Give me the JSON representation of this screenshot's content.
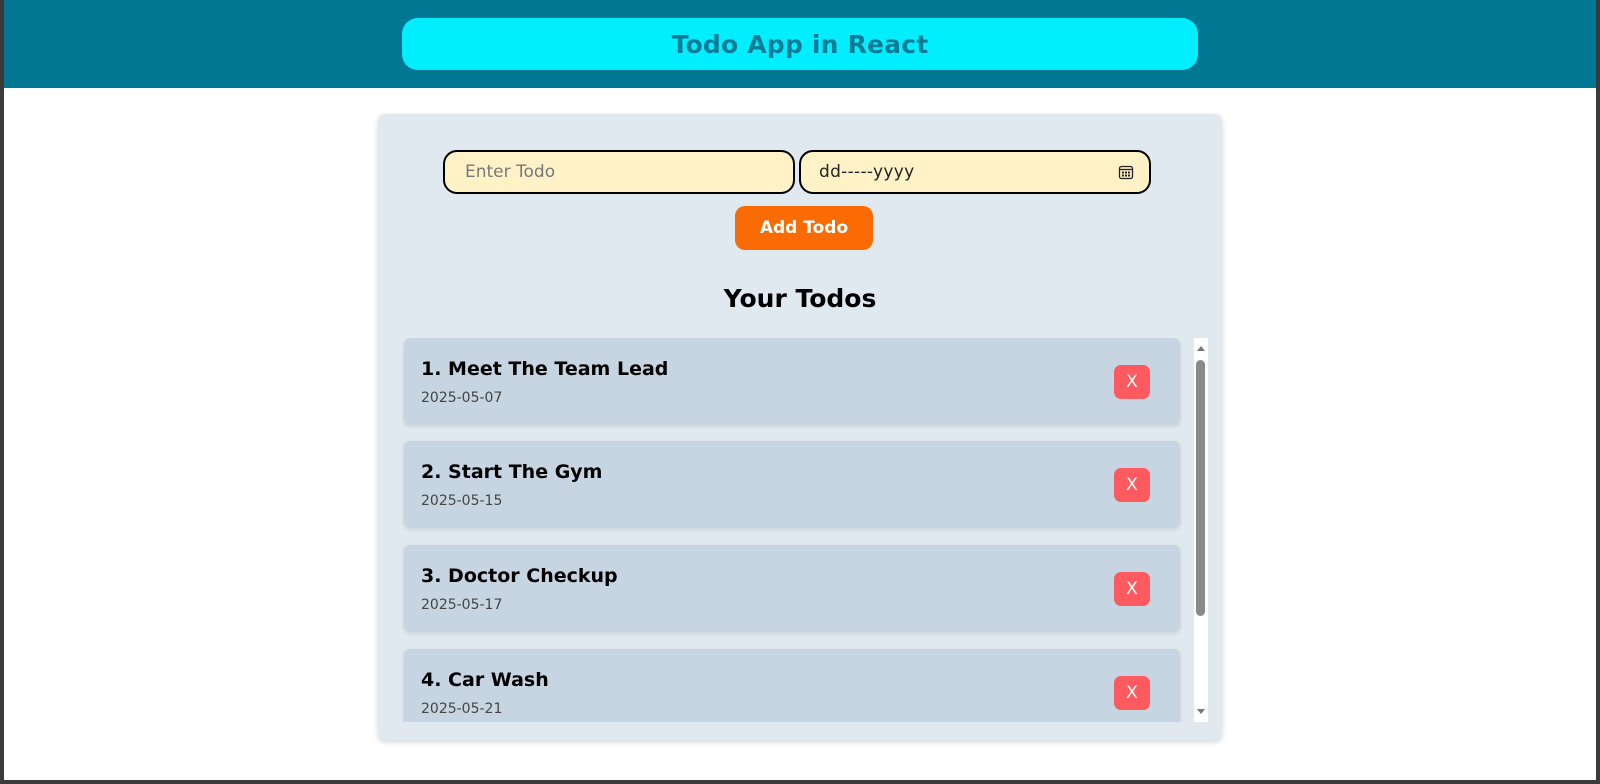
{
  "header": {
    "title": "Todo App in React"
  },
  "form": {
    "todo_placeholder": "Enter Todo",
    "todo_value": "",
    "date_placeholder": "dd-----yyyy",
    "add_button_label": "Add Todo"
  },
  "list": {
    "heading": "Your Todos",
    "delete_label": "X",
    "items": [
      {
        "text": "1. Meet The Team Lead",
        "date": "2025-05-07"
      },
      {
        "text": "2. Start The Gym",
        "date": "2025-05-15"
      },
      {
        "text": "3. Doctor Checkup",
        "date": "2025-05-17"
      },
      {
        "text": "4. Car Wash",
        "date": "2025-05-21"
      }
    ]
  },
  "colors": {
    "header_bg": "#007894",
    "title_pill": "#00eeff",
    "title_text": "#0a7c95",
    "card_bg": "#e0e8f0",
    "input_bg": "#fff2c6",
    "add_button": "#fb6b04",
    "item_bg": "#c6d5e1",
    "delete_button": "#ff5a5f"
  },
  "icons": {
    "date_picker": "calendar-icon",
    "scroll_up": "scroll-up-arrow-icon",
    "scroll_down": "scroll-down-arrow-icon"
  }
}
